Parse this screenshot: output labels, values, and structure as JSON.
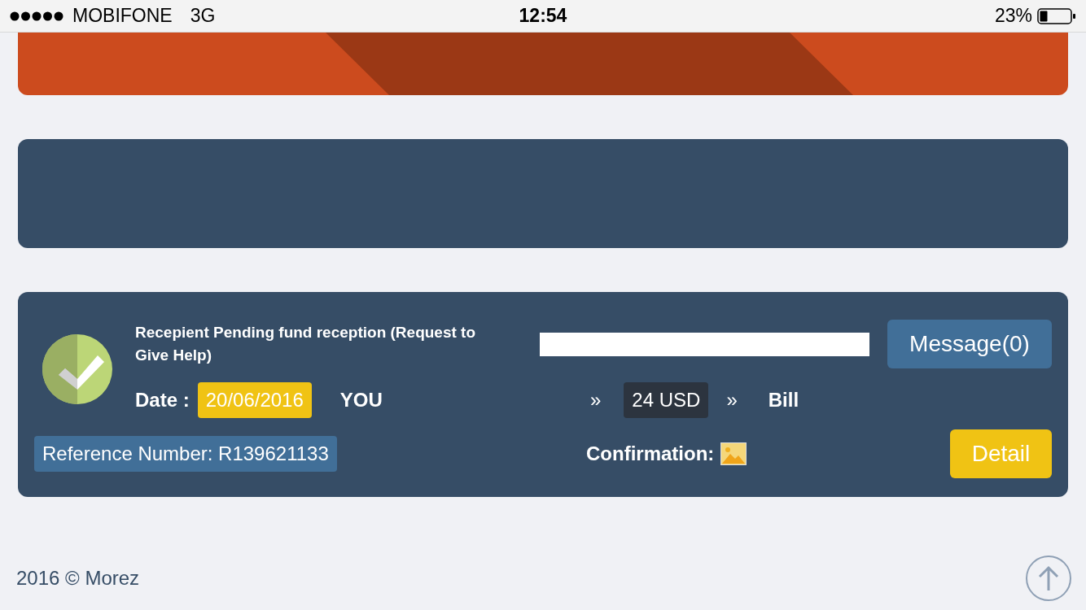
{
  "status_bar": {
    "carrier": "MOBIFONE",
    "network": "3G",
    "time": "12:54",
    "battery": "23%"
  },
  "transaction": {
    "title": "Recepient Pending fund reception (Request to Give Help)",
    "message_button": "Message(0)",
    "date_label": "Date :",
    "date": "20/06/2016",
    "sender": "YOU",
    "arrow_1": "»",
    "amount": "24 USD",
    "arrow_2": "»",
    "recipient": "Bill",
    "reference": "Reference Number: R139621133",
    "confirmation_label": "Confirmation:",
    "detail_button": "Detail"
  },
  "footer": {
    "copyright": "2016 © Morez"
  }
}
